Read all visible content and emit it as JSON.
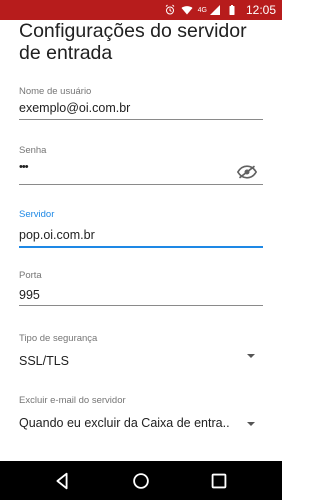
{
  "status_bar": {
    "network": "4G",
    "time": "12:05"
  },
  "page": {
    "title": "Configurações do servidor de entrada"
  },
  "fields": {
    "username": {
      "label": "Nome de usuário",
      "value": "exemplo@oi.com.br"
    },
    "password": {
      "label": "Senha",
      "value": "•••"
    },
    "server": {
      "label": "Servidor",
      "value": "pop.oi.com.br"
    },
    "port": {
      "label": "Porta",
      "value": "995"
    },
    "security": {
      "label": "Tipo de segurança",
      "value": "SSL/TLS"
    },
    "delete_from_server": {
      "label": "Excluir e-mail do servidor",
      "value": "Quando eu excluir da Caixa de entra.."
    }
  },
  "icons": {
    "alarm": "alarm-icon",
    "wifi": "wifi-icon",
    "signal": "signal-icon",
    "battery": "battery-icon",
    "visibility": "visibility-off-icon",
    "back": "back-icon",
    "home": "home-icon",
    "recents": "recents-icon"
  },
  "colors": {
    "status_bar": "#b71c1c",
    "focus": "#1e88e5",
    "label": "#757575",
    "text": "#212121",
    "nav_bar": "#000000"
  }
}
